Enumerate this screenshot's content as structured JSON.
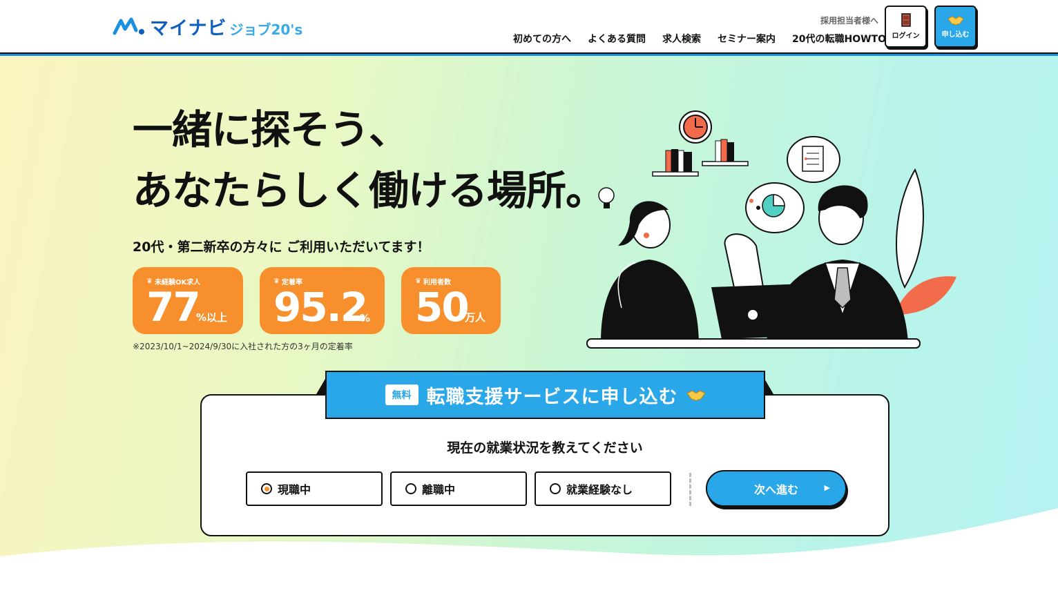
{
  "header": {
    "logo_main": "マイナビ",
    "logo_sub": "ジョブ20's",
    "recruiter_link": "採用担当者様へ",
    "nav": [
      "初めての方へ",
      "よくある質問",
      "求人検索",
      "セミナー案内",
      "20代の転職HOWTO"
    ],
    "login_label": "ログイン",
    "apply_label": "申し込む"
  },
  "hero": {
    "headline_line1": "一緒に探そう、",
    "headline_line2": "あなたらしく働ける場所。",
    "subline": "20代・第二新卒の方々に ご利用いただいてます！",
    "stats": [
      {
        "label": "未経験OK求人",
        "value": "77",
        "unit": "%以上"
      },
      {
        "label": "定着率",
        "value": "95.2",
        "unit": "%"
      },
      {
        "label": "利用者数",
        "value": "50",
        "unit": "万人"
      }
    ],
    "footnote": "※2023/10/1~2024/9/30に入社された方の3ヶ月の定着率"
  },
  "form": {
    "badge": "無料",
    "title": "転職支援サービスに申し込む",
    "question": "現在の就業状況を教えてください",
    "options": [
      "現職中",
      "離職中",
      "就業経験なし"
    ],
    "selected_option": "現職中",
    "next_label": "次へ進む"
  },
  "colors": {
    "brand_blue": "#29a7e8",
    "logo_blue": "#0f5fbf",
    "stat_orange": "#f7902c",
    "accent_red": "#f26b4a"
  }
}
